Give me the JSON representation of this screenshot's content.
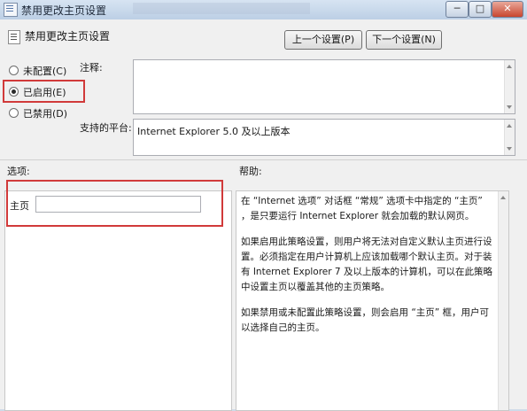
{
  "window": {
    "title": "禁用更改主页设置",
    "minimize_glyph": "─",
    "maximize_glyph": "□",
    "close_glyph": "✕"
  },
  "header": {
    "title": "禁用更改主页设置",
    "prev_button": "上一个设置(P)",
    "next_button": "下一个设置(N)"
  },
  "state": {
    "options": [
      {
        "label": "未配置(C)",
        "checked": false
      },
      {
        "label": "已启用(E)",
        "checked": true
      },
      {
        "label": "已禁用(D)",
        "checked": false
      }
    ]
  },
  "comment": {
    "label": "注释:",
    "value": ""
  },
  "platform": {
    "label": "支持的平台:",
    "value": "Internet Explorer 5.0 及以上版本"
  },
  "options_section": {
    "label": "选项:",
    "homepage_label": "主页",
    "homepage_value": ""
  },
  "help_section": {
    "label": "帮助:",
    "paragraphs": [
      "在 “Internet 选项” 对话框 “常规” 选项卡中指定的 “主页” ，是只要运行 Internet Explorer 就会加载的默认网页。",
      "如果启用此策略设置，则用户将无法对自定义默认主页进行设置。必须指定在用户计算机上应该加载哪个默认主页。对于装有 Internet Explorer 7 及以上版本的计算机，可以在此策略中设置主页以覆盖其他的主页策略。",
      "如果禁用或未配置此策略设置，则会启用 “主页” 框，用户可以选择自己的主页。"
    ]
  },
  "colors": {
    "highlight_box": "#d13a3a",
    "titlebar": "#c8d8ea"
  }
}
